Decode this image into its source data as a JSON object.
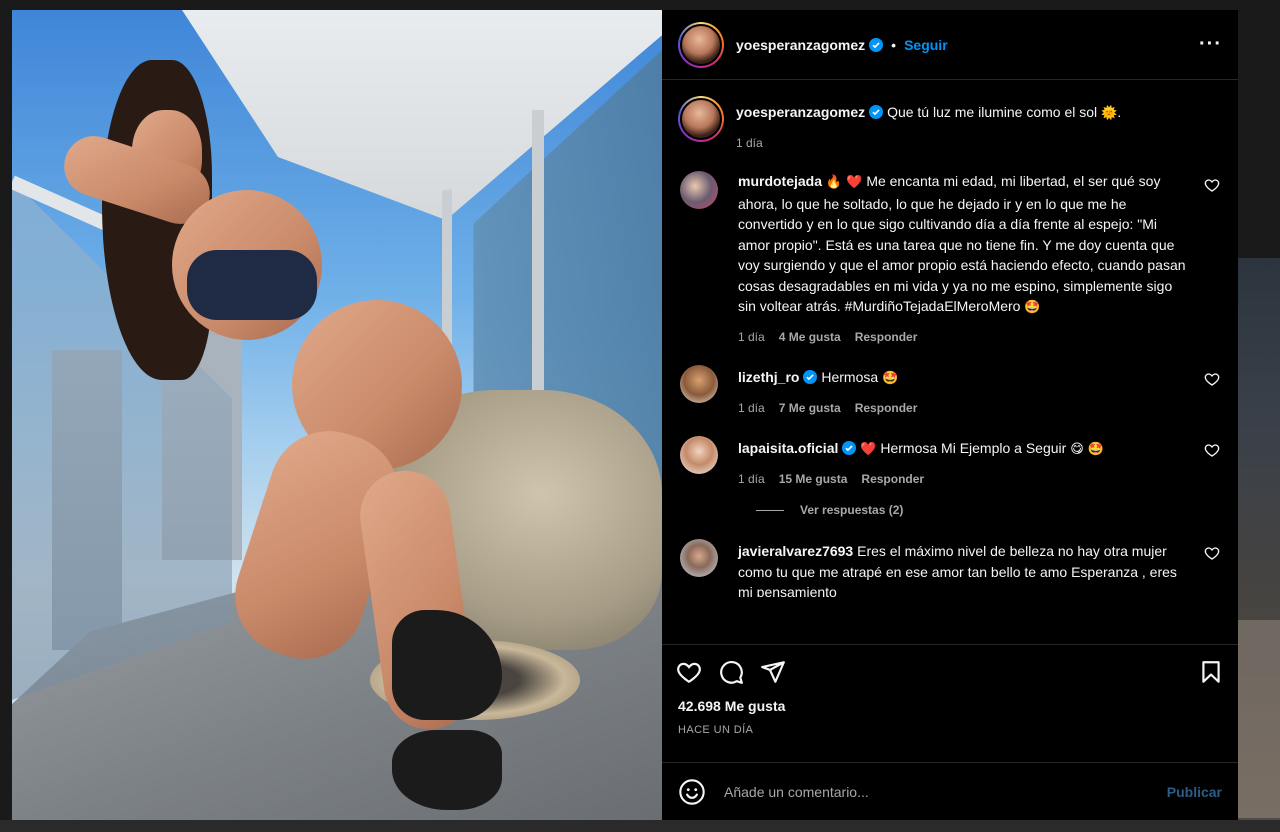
{
  "post": {
    "username": "yoesperanzagomez",
    "follow_label": "Seguir",
    "dot": "•",
    "more_label": "···",
    "photo_alt": "",
    "caption": {
      "text": "Que tú luz me ilumine como el sol",
      "emoji": "🌞",
      "suffix": ".",
      "time": "1 día"
    }
  },
  "comments": [
    {
      "username": "murdotejada",
      "emoji_prefix": "🔥 ❤️",
      "text": "Me encanta mi edad, mi libertad, el ser qué soy ahora, lo que he soltado, lo que he dejado ir y en lo que me he convertido y en lo que sigo cultivando día a día frente al espejo: \"Mi amor propio\". Está es una tarea que no tiene fin. Y me doy cuenta que voy surgiendo y que el amor propio está haciendo efecto, cuando pasan cosas desagradables en mi vida y ya no me espino, simplemente sigo sin voltear atrás. #MurdiñoTejadaElMeroMero",
      "emoji_suffix": "🤩",
      "time": "1 día",
      "likes": "4 Me gusta",
      "reply": "Responder"
    },
    {
      "username": "lizethj_ro",
      "text": "Hermosa",
      "emoji_suffix": "🤩",
      "time": "1 día",
      "likes": "7 Me gusta",
      "reply": "Responder"
    },
    {
      "username": "lapaisita.oficial",
      "emoji_prefix": "❤️",
      "text": "Hermosa Mi Ejemplo a Seguir",
      "emoji_suffix": "😋 🤩",
      "time": "1 día",
      "likes": "15 Me gusta",
      "reply": "Responder"
    },
    {
      "username": "javieralvarez7693",
      "text": "Eres el máximo nivel de belleza no hay otra mujer como tu que me atrapé en ese amor tan bello te amo Esperanza , eres mi pensamiento"
    }
  ],
  "view_replies": "Ver respuestas (2)",
  "likes_count": "42.698 Me gusta",
  "posted_when": "HACE UN DÍA",
  "add_comment": {
    "placeholder": "Añade un comentario...",
    "publish": "Publicar"
  },
  "colors": {
    "accent": "#0095f6",
    "verified": "#0095f6",
    "muted": "#a8a8a8",
    "publish_disabled": "#2c5d86",
    "background": "#000000"
  },
  "icons": {
    "like": "heart-icon",
    "comment": "comment-icon",
    "share": "paper-plane-icon",
    "save": "bookmark-icon",
    "emoji": "smiley-icon",
    "more": "more-options-icon",
    "verified": "verified-badge-icon"
  }
}
